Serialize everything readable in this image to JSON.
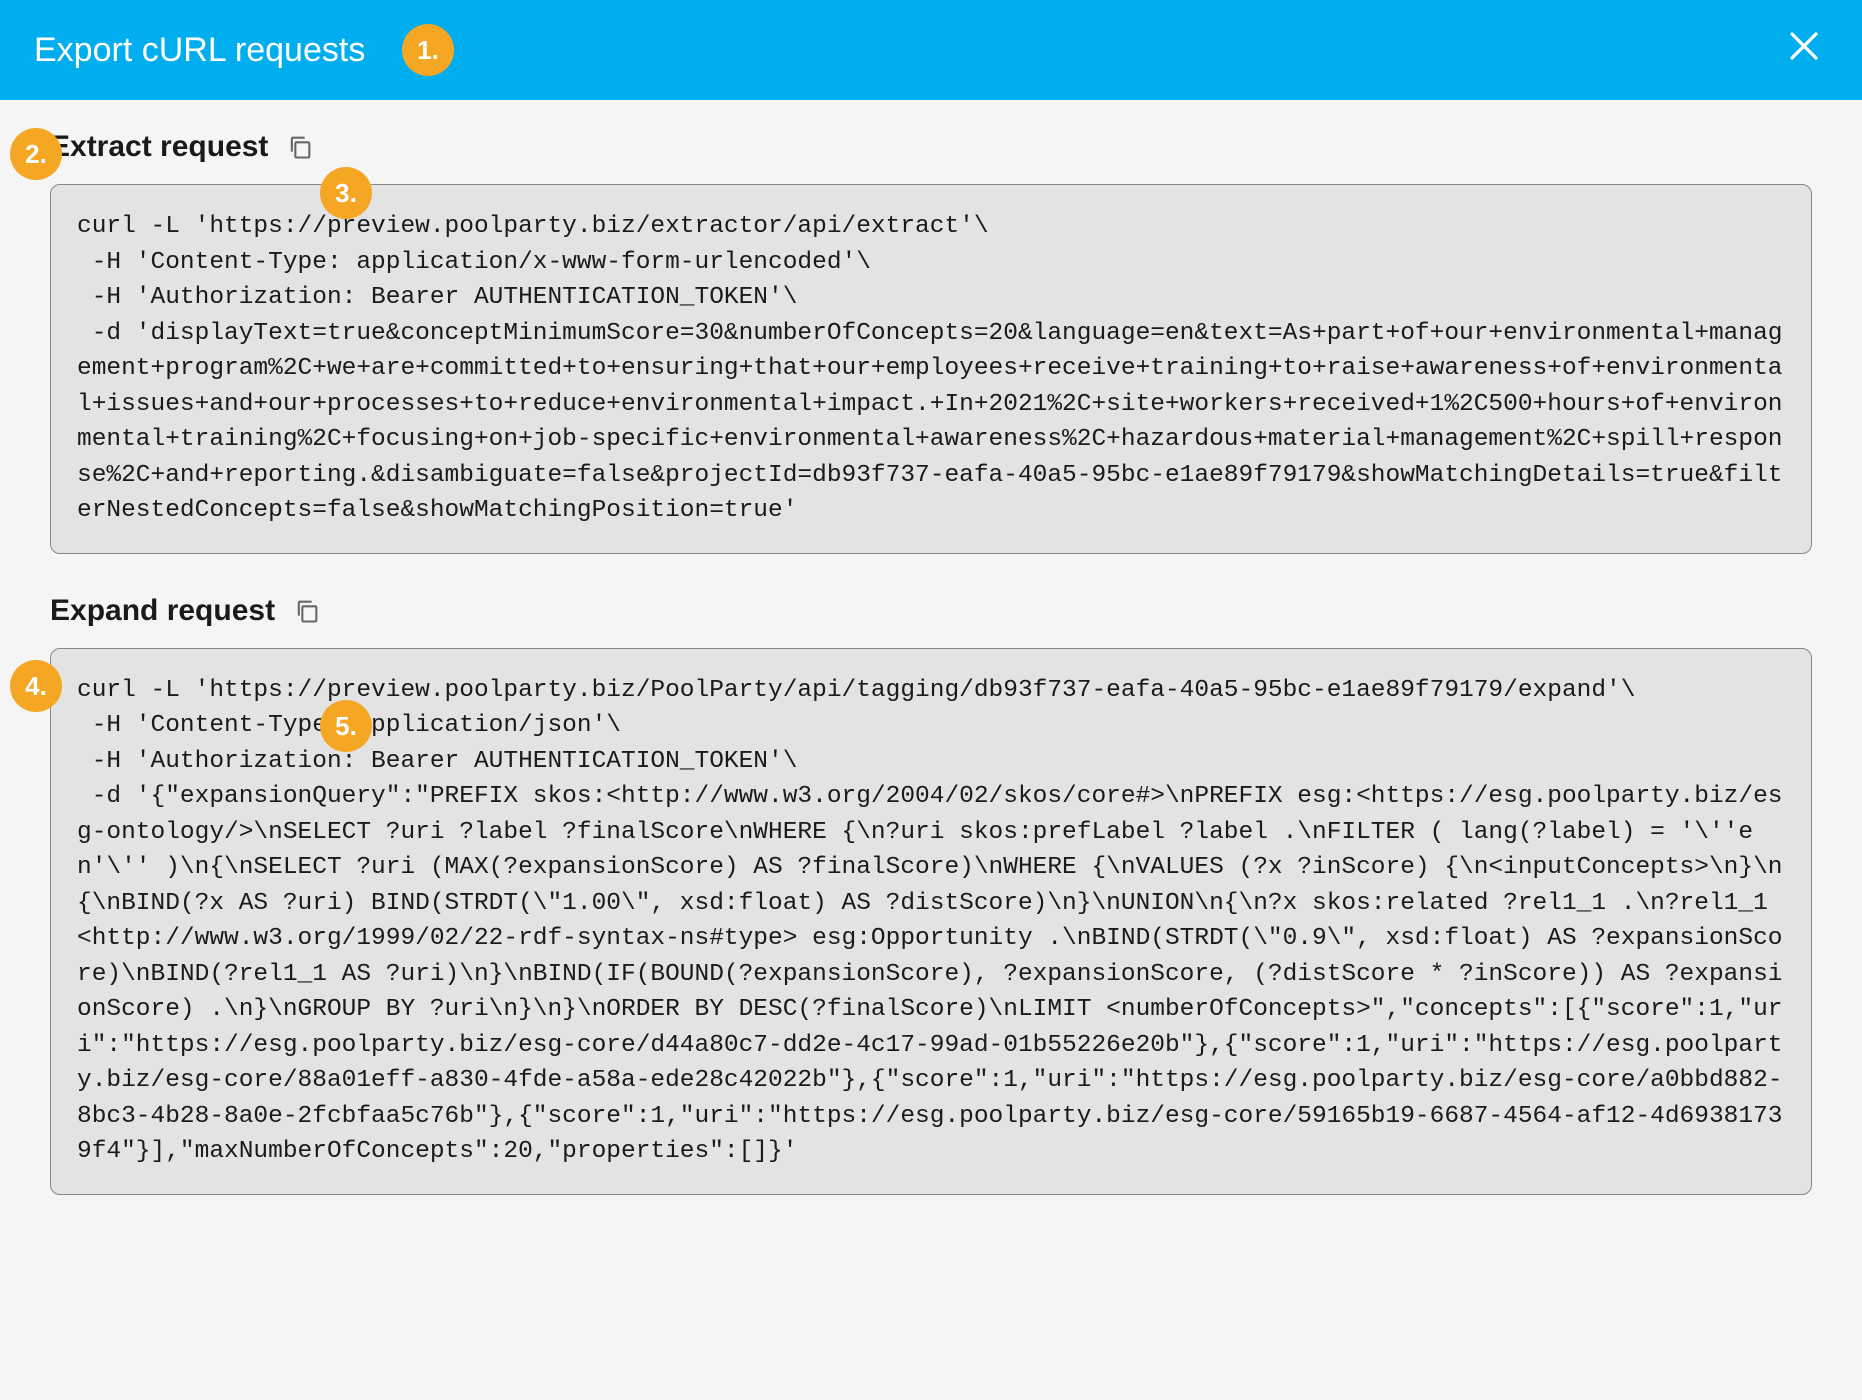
{
  "header": {
    "title": "Export cURL requests"
  },
  "badges": {
    "b1": "1.",
    "b2": "2.",
    "b3": "3.",
    "b4": "4.",
    "b5": "5."
  },
  "sections": {
    "extract": {
      "title": "Extract request",
      "code": "curl -L 'https://preview.poolparty.biz/extractor/api/extract'\\\n -H 'Content-Type: application/x-www-form-urlencoded'\\\n -H 'Authorization: Bearer AUTHENTICATION_TOKEN'\\\n -d 'displayText=true&conceptMinimumScore=30&numberOfConcepts=20&language=en&text=As+part+of+our+environmental+management+program%2C+we+are+committed+to+ensuring+that+our+employees+receive+training+to+raise+awareness+of+environmental+issues+and+our+processes+to+reduce+environmental+impact.+In+2021%2C+site+workers+received+1%2C500+hours+of+environmental+training%2C+focusing+on+job-specific+environmental+awareness%2C+hazardous+material+management%2C+spill+response%2C+and+reporting.&disambiguate=false&projectId=db93f737-eafa-40a5-95bc-e1ae89f79179&showMatchingDetails=true&filterNestedConcepts=false&showMatchingPosition=true'"
    },
    "expand": {
      "title": "Expand request",
      "code": "curl -L 'https://preview.poolparty.biz/PoolParty/api/tagging/db93f737-eafa-40a5-95bc-e1ae89f79179/expand'\\\n -H 'Content-Type: application/json'\\\n -H 'Authorization: Bearer AUTHENTICATION_TOKEN'\\\n -d '{\"expansionQuery\":\"PREFIX skos:<http://www.w3.org/2004/02/skos/core#>\\nPREFIX esg:<https://esg.poolparty.biz/esg-ontology/>\\nSELECT ?uri ?label ?finalScore\\nWHERE {\\n?uri skos:prefLabel ?label .\\nFILTER ( lang(?label) = '\\''en'\\'' )\\n{\\nSELECT ?uri (MAX(?expansionScore) AS ?finalScore)\\nWHERE {\\nVALUES (?x ?inScore) {\\n<inputConcepts>\\n}\\n{\\nBIND(?x AS ?uri) BIND(STRDT(\\\"1.00\\\", xsd:float) AS ?distScore)\\n}\\nUNION\\n{\\n?x skos:related ?rel1_1 .\\n?rel1_1 <http://www.w3.org/1999/02/22-rdf-syntax-ns#type> esg:Opportunity .\\nBIND(STRDT(\\\"0.9\\\", xsd:float) AS ?expansionScore)\\nBIND(?rel1_1 AS ?uri)\\n}\\nBIND(IF(BOUND(?expansionScore), ?expansionScore, (?distScore * ?inScore)) AS ?expansionScore) .\\n}\\nGROUP BY ?uri\\n}\\n}\\nORDER BY DESC(?finalScore)\\nLIMIT <numberOfConcepts>\",\"concepts\":[{\"score\":1,\"uri\":\"https://esg.poolparty.biz/esg-core/d44a80c7-dd2e-4c17-99ad-01b55226e20b\"},{\"score\":1,\"uri\":\"https://esg.poolparty.biz/esg-core/88a01eff-a830-4fde-a58a-ede28c42022b\"},{\"score\":1,\"uri\":\"https://esg.poolparty.biz/esg-core/a0bbd882-8bc3-4b28-8a0e-2fcbfaa5c76b\"},{\"score\":1,\"uri\":\"https://esg.poolparty.biz/esg-core/59165b19-6687-4564-af12-4d69381739f4\"}],\"maxNumberOfConcepts\":20,\"properties\":[]}'"
    }
  }
}
